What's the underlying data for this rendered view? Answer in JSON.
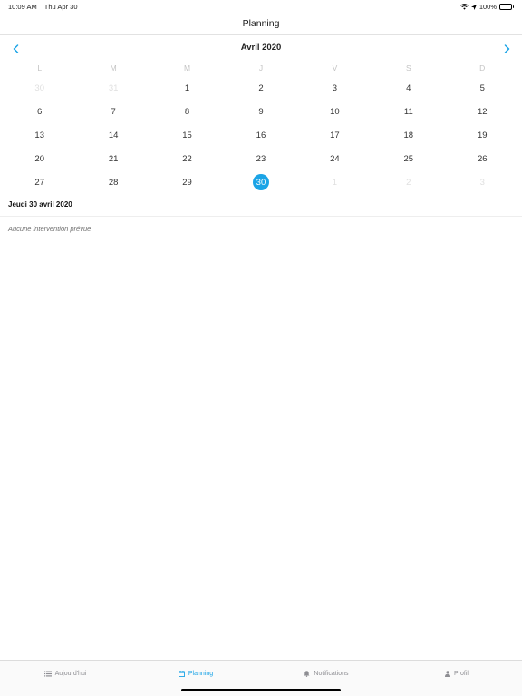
{
  "status_bar": {
    "time": "10:09 AM",
    "date": "Thu Apr 30",
    "battery": "100%"
  },
  "header": {
    "title": "Planning"
  },
  "calendar": {
    "month_label": "Avril 2020",
    "weekdays": [
      "L",
      "M",
      "M",
      "J",
      "V",
      "S",
      "D"
    ],
    "weeks": [
      [
        {
          "n": "30",
          "m": true
        },
        {
          "n": "31",
          "m": true
        },
        {
          "n": "1"
        },
        {
          "n": "2"
        },
        {
          "n": "3"
        },
        {
          "n": "4"
        },
        {
          "n": "5"
        }
      ],
      [
        {
          "n": "6"
        },
        {
          "n": "7"
        },
        {
          "n": "8"
        },
        {
          "n": "9"
        },
        {
          "n": "10"
        },
        {
          "n": "11"
        },
        {
          "n": "12"
        }
      ],
      [
        {
          "n": "13"
        },
        {
          "n": "14"
        },
        {
          "n": "15"
        },
        {
          "n": "16"
        },
        {
          "n": "17"
        },
        {
          "n": "18"
        },
        {
          "n": "19"
        }
      ],
      [
        {
          "n": "20"
        },
        {
          "n": "21"
        },
        {
          "n": "22"
        },
        {
          "n": "23"
        },
        {
          "n": "24"
        },
        {
          "n": "25"
        },
        {
          "n": "26"
        }
      ],
      [
        {
          "n": "27"
        },
        {
          "n": "28"
        },
        {
          "n": "29"
        },
        {
          "n": "30",
          "s": true
        },
        {
          "n": "1",
          "m": true
        },
        {
          "n": "2",
          "m": true
        },
        {
          "n": "3",
          "m": true
        }
      ]
    ],
    "accent_color": "#1ba4e6"
  },
  "agenda": {
    "selected_date": "Jeudi 30 avril 2020",
    "empty_message": "Aucune intervention prévue"
  },
  "tab_bar": {
    "items": [
      {
        "label": "Aujourd'hui",
        "icon": "list-icon",
        "active": false
      },
      {
        "label": "Planning",
        "icon": "calendar-icon",
        "active": true
      },
      {
        "label": "Notifications",
        "icon": "bell-icon",
        "active": false
      },
      {
        "label": "Profil",
        "icon": "person-icon",
        "active": false
      }
    ]
  }
}
